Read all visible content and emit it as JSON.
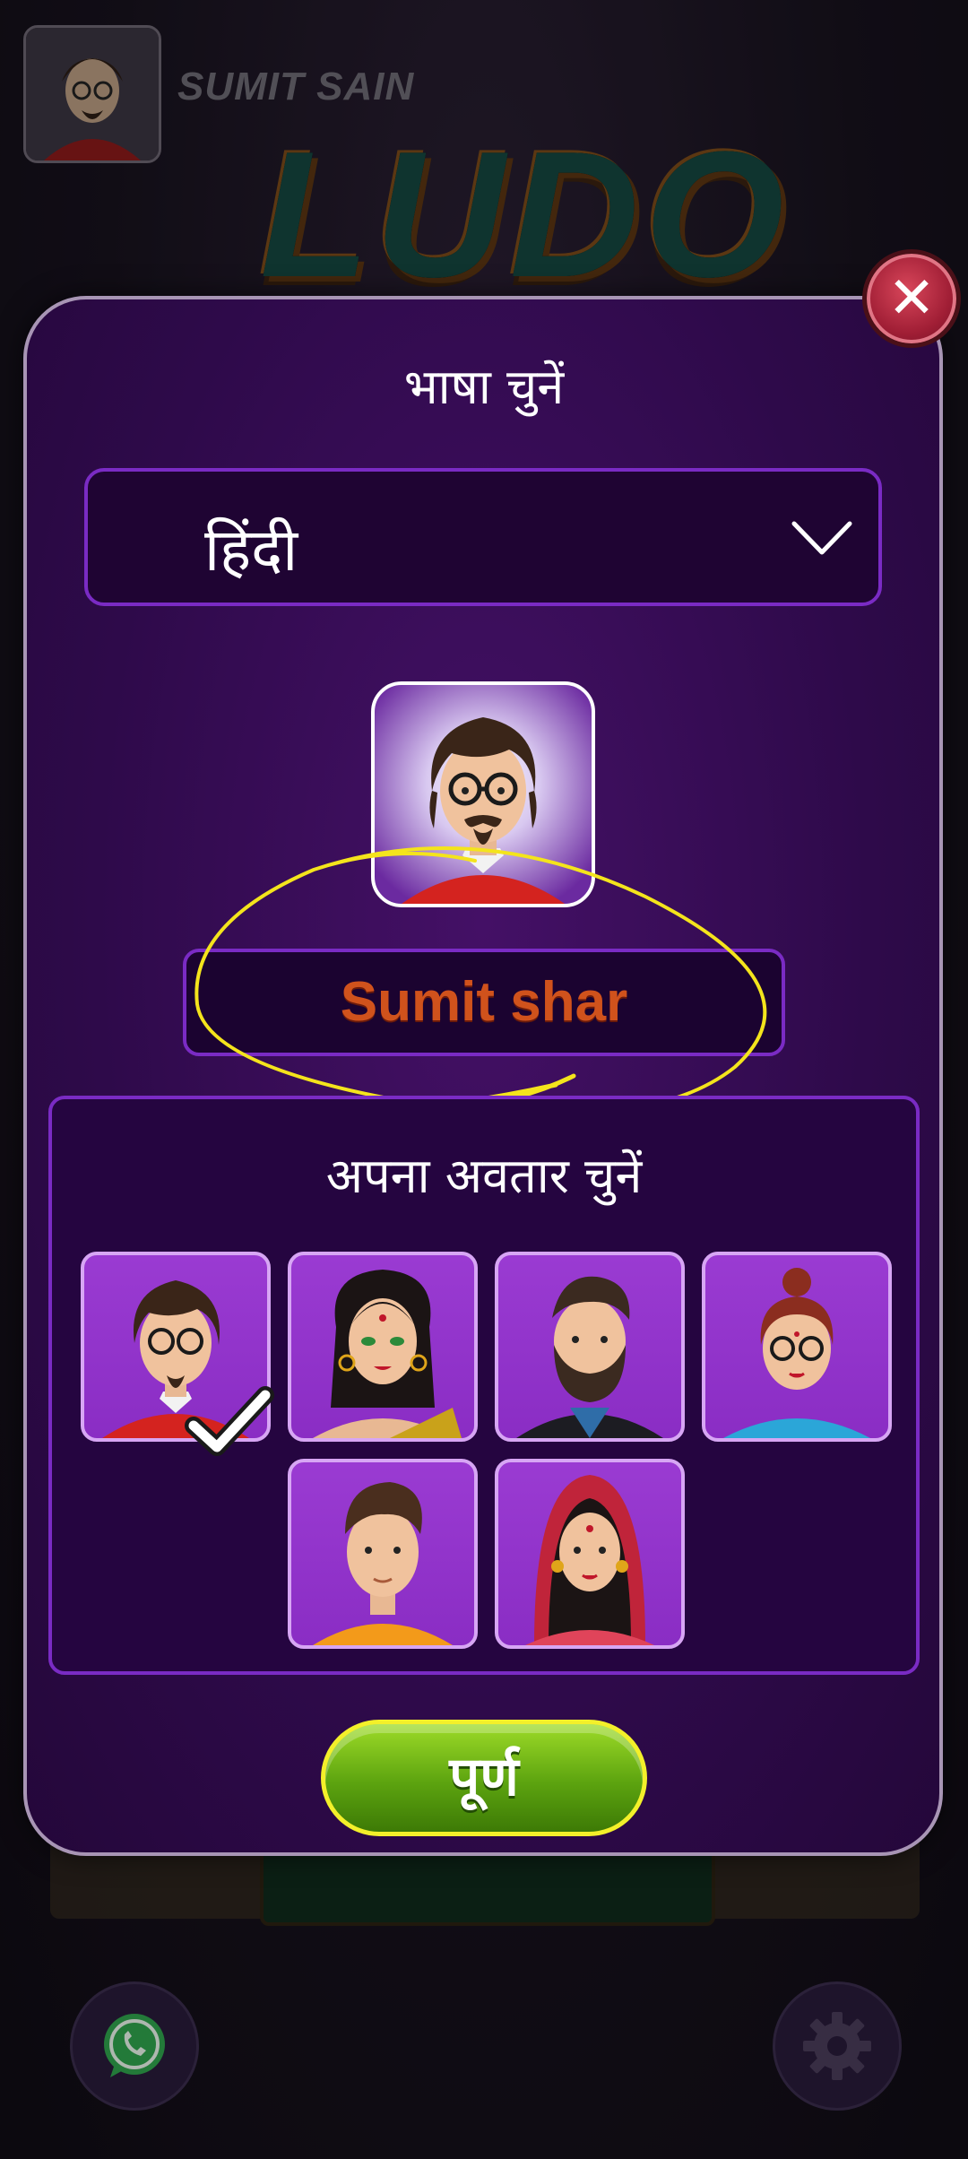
{
  "background": {
    "player_name": "SUMIT SAIN",
    "logo_text": "LUDO"
  },
  "dialog": {
    "close_label": "✕",
    "language_title": "भाषा चुनें",
    "language_selected": "हिंदी",
    "player_name_value": "Sumit shar",
    "avatar_title": "अपना अवतार चुनें",
    "selected_avatar_index": 0,
    "avatars": [
      {
        "name": "man-glasses-beard"
      },
      {
        "name": "woman-bindi"
      },
      {
        "name": "man-full-beard"
      },
      {
        "name": "woman-glasses-bun"
      },
      {
        "name": "young-man"
      },
      {
        "name": "bride"
      }
    ],
    "done_label": "पूर्ण"
  },
  "colors": {
    "dialog_bg": "#2e0a4a",
    "accent_border": "#7a2bc4",
    "name_text": "#d0521c",
    "done_button": "#5ca30f",
    "annotation": "#f4e41c"
  },
  "icons": [
    "close-icon",
    "chevron-down-icon",
    "check-icon",
    "whatsapp-icon",
    "gear-icon"
  ]
}
